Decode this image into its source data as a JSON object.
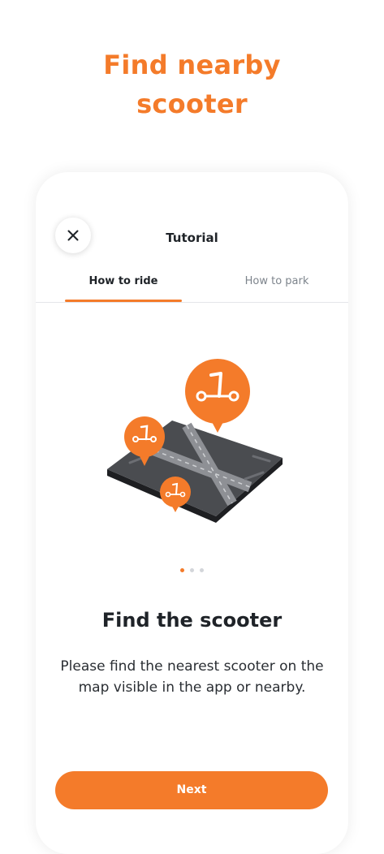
{
  "headline": {
    "line1": "Find nearby",
    "line2": "scooter"
  },
  "modal": {
    "title": "Tutorial",
    "close_icon": "close-icon",
    "tabs": [
      {
        "label": "How to ride",
        "active": true
      },
      {
        "label": "How to park",
        "active": false
      }
    ]
  },
  "slide": {
    "illustration_icon": "map-scooter-pins-icon",
    "pager": {
      "current": 1,
      "total": 3
    },
    "title": "Find the scooter",
    "description": "Please find the nearest scooter on the map visible in the app or nearby."
  },
  "next_button": {
    "label": "Next"
  },
  "colors": {
    "accent": "#F47B2A",
    "text_primary": "#1f2328",
    "text_muted": "#7d848c",
    "map_dark": "#4a4c50",
    "map_light": "#8e9095"
  }
}
